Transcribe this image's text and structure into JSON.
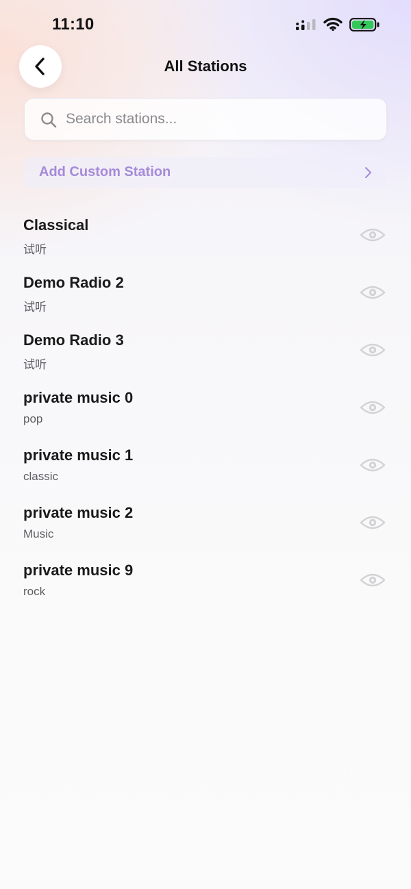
{
  "status_bar": {
    "time": "11:10",
    "icons": [
      "signal-icon",
      "wifi-icon",
      "battery-charging-icon"
    ]
  },
  "header": {
    "title": "All Stations",
    "back_icon": "chevron-left-icon"
  },
  "search": {
    "placeholder": "Search stations...",
    "value": "",
    "icon": "search-icon"
  },
  "custom_station": {
    "label": "Add Custom Station",
    "icon": "chevron-right-icon"
  },
  "stations": [
    {
      "name": "Classical",
      "genre": "试听"
    },
    {
      "name": "Demo Radio 2",
      "genre": "试听"
    },
    {
      "name": "Demo Radio 3",
      "genre": "试听"
    },
    {
      "name": "private music 0",
      "genre": "pop"
    },
    {
      "name": "private music 1",
      "genre": "classic"
    },
    {
      "name": "private music 2",
      "genre": "Music"
    },
    {
      "name": "private music 9",
      "genre": "rock"
    }
  ],
  "colors": {
    "accent": "#a58ad8",
    "battery": "#34c759",
    "eye_icon": "#d3d3d6"
  }
}
